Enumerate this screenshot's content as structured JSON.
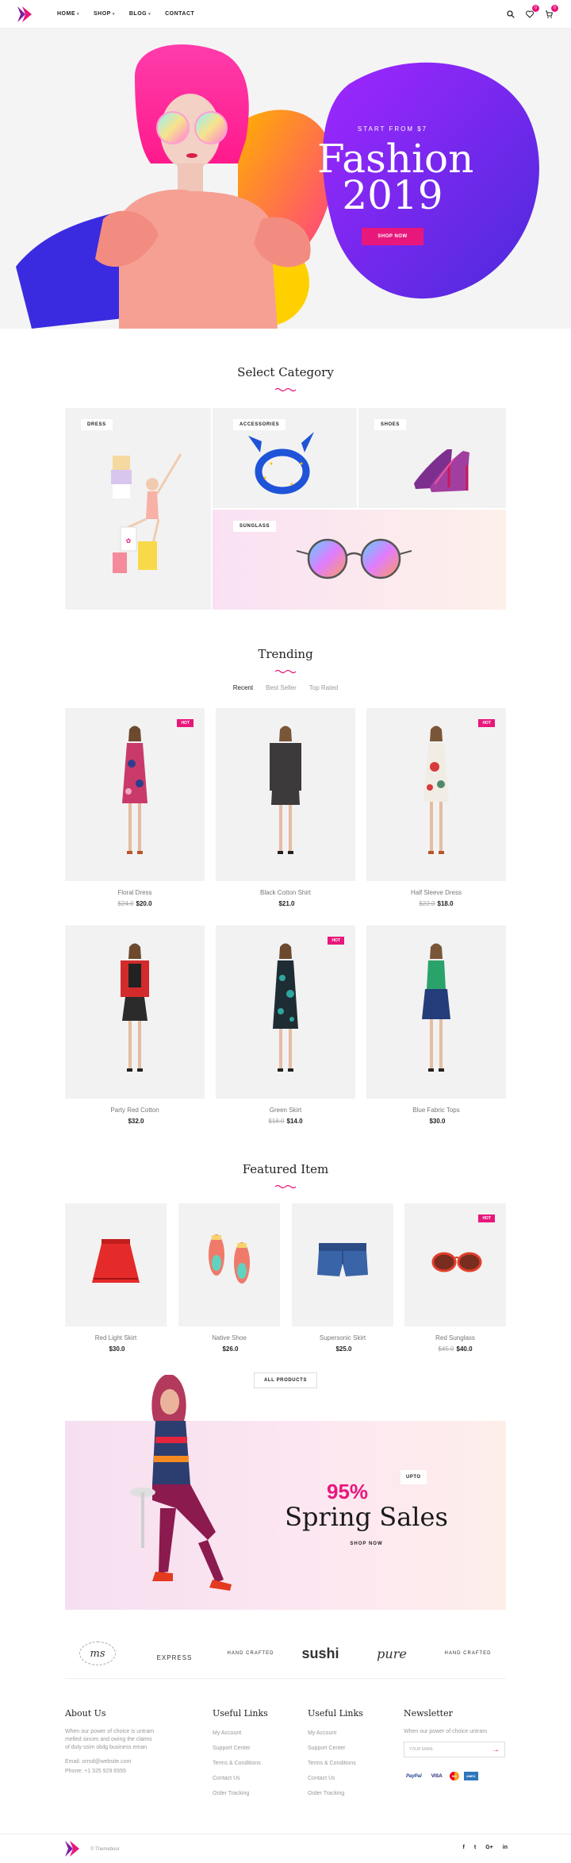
{
  "header": {
    "nav": [
      {
        "label": "HOME",
        "caret": "▾"
      },
      {
        "label": "SHOP",
        "caret": "▾"
      },
      {
        "label": "BLOG",
        "caret": "▾"
      },
      {
        "label": "CONTACT",
        "caret": ""
      }
    ],
    "wishlist_count": "0",
    "cart_count": "0",
    "icons": [
      "search-icon",
      "heart-icon",
      "cart-icon"
    ]
  },
  "hero": {
    "subtitle": "START FROM $7",
    "title_line1": "Fashion",
    "title_line2": "2019",
    "button": "SHOP NOW"
  },
  "categories": {
    "title": "Select Category",
    "items": [
      "DRESS",
      "ACCESSORIES",
      "SHOES",
      "SUNGLASS"
    ]
  },
  "trending": {
    "title": "Trending",
    "tabs": [
      "Recent",
      "Best Seller",
      "Top Rated"
    ],
    "products": [
      {
        "name": "Floral Dress",
        "old_price": "$24.0",
        "price": "$20.0",
        "badge": "HOT"
      },
      {
        "name": "Black Cotton Shirt",
        "old_price": "",
        "price": "$21.0",
        "badge": ""
      },
      {
        "name": "Half Sleeve Dress",
        "old_price": "$22.0",
        "price": "$18.0",
        "badge": "HOT"
      },
      {
        "name": "Party Red Cotton",
        "old_price": "",
        "price": "$32.0",
        "badge": ""
      },
      {
        "name": "Green Skirt",
        "old_price": "$18.0",
        "price": "$14.0",
        "badge": "HOT"
      },
      {
        "name": "Blue Fabric Tops",
        "old_price": "",
        "price": "$30.0",
        "badge": ""
      }
    ]
  },
  "featured": {
    "title": "Featured Item",
    "products": [
      {
        "name": "Red Light Skirt",
        "old_price": "",
        "price": "$30.0",
        "badge": ""
      },
      {
        "name": "Native Shoe",
        "old_price": "",
        "price": "$26.0",
        "badge": ""
      },
      {
        "name": "Supersonic Skirt",
        "old_price": "",
        "price": "$25.0",
        "badge": ""
      },
      {
        "name": "Red Sunglass",
        "old_price": "$45.0",
        "price": "$40.0",
        "badge": "HOT"
      }
    ],
    "all_button": "ALL PRODUCTS"
  },
  "banner": {
    "upto": "UPTO",
    "percent": "95%",
    "title": "Spring Sales",
    "link": "SHOP NOW"
  },
  "brands": [
    "ms",
    "EXPRESS",
    "HAND CRAFTED",
    "sushi",
    "pure",
    "HAND CRAFTED"
  ],
  "footer": {
    "about": {
      "title": "About Us",
      "text1": "When our power of choice is untram",
      "text2": "melled sinces and owing the claims",
      "text3": "of duty ssim obilg business eman",
      "email": "Email: orrsd@website.com",
      "phone": "Phone: +1 325 929 6555"
    },
    "links1": {
      "title": "Useful Links",
      "items": [
        "My Account",
        "Support Center",
        "Terms & Conditions",
        "Contact Us",
        "Order Tracking"
      ]
    },
    "links2": {
      "title": "Useful Links",
      "items": [
        "My Account",
        "Support Center",
        "Terms & Conditions",
        "Contact Us",
        "Order Tracking"
      ]
    },
    "newsletter": {
      "title": "Newsletter",
      "text": "When our power of choice untram",
      "placeholder": "YOUR EMAIL",
      "payments": [
        "PayPal",
        "VISA",
        "MC",
        "AMEX"
      ]
    },
    "copyright": "© Themeboor",
    "socials": [
      "f",
      "t",
      "G+",
      "in"
    ]
  },
  "colors": {
    "accent": "#e8177c",
    "card_bg": "#f2f2f2"
  }
}
